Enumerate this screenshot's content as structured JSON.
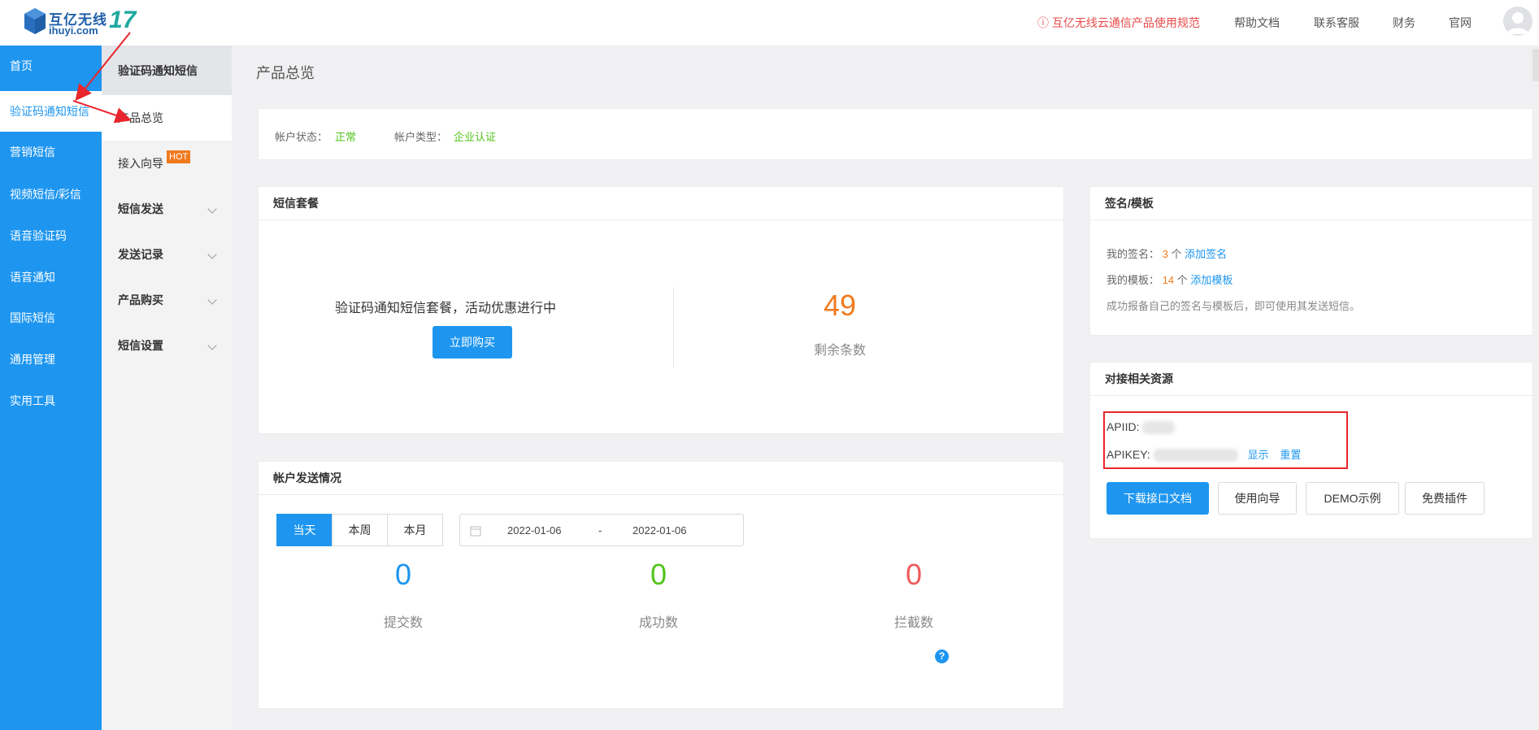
{
  "header": {
    "logo": {
      "brand": "互亿无线",
      "domain": "ihuyi.com",
      "number": "17"
    },
    "notice": "ⓘ 互亿无线云通信产品使用规范",
    "links": [
      "帮助文档",
      "联系客服",
      "财务",
      "官网"
    ]
  },
  "sidebar": {
    "items": [
      {
        "label": "首页"
      },
      {
        "label": "验证码通知短信"
      },
      {
        "label": "营销短信"
      },
      {
        "label": "视频短信/彩信"
      },
      {
        "label": "语音验证码"
      },
      {
        "label": "语音通知"
      },
      {
        "label": "国际短信"
      },
      {
        "label": "通用管理"
      },
      {
        "label": "实用工具"
      }
    ]
  },
  "subsidebar": {
    "title": "验证码通知短信",
    "items": [
      {
        "label": "产品总览"
      },
      {
        "label": "接入向导",
        "badge": "HOT"
      },
      {
        "label": "短信发送"
      },
      {
        "label": "发送记录"
      },
      {
        "label": "产品购买"
      },
      {
        "label": "短信设置"
      }
    ]
  },
  "main": {
    "page_title": "产品总览",
    "account": {
      "status_label": "帐户状态：",
      "status_value": "正常",
      "type_label": "帐户类型：",
      "type_value": "企业认证"
    },
    "package": {
      "title": "短信套餐",
      "promo": "验证码通知短信套餐，活动优惠进行中",
      "buy_button": "立即购买",
      "remaining_value": "49",
      "remaining_label": "剩余条数"
    },
    "sending": {
      "title": "帐户发送情况",
      "tabs": [
        "当天",
        "本周",
        "本月"
      ],
      "date_start": "2022-01-06",
      "date_sep": "-",
      "date_end": "2022-01-06",
      "stats": [
        {
          "value": "0",
          "label": "提交数",
          "color": "#1e96f0"
        },
        {
          "value": "0",
          "label": "成功数",
          "color": "#52c41a"
        },
        {
          "value": "0",
          "label": "拦截数",
          "color": "#f05b5b"
        }
      ],
      "help_icon": "?"
    },
    "signature": {
      "title": "签名/模板",
      "sig_label": "我的签名：",
      "sig_count": "3",
      "sig_unit": "个",
      "sig_add": "添加签名",
      "tpl_label": "我的模板：",
      "tpl_count": "14",
      "tpl_unit": "个",
      "tpl_add": "添加模板",
      "note": "成功报备自己的签名与模板后，即可使用其发送短信。"
    },
    "resources": {
      "title": "对接相关资源",
      "apiid_label": "APIID:",
      "apikey_label": "APIKEY:",
      "show_link": "显示",
      "reset_link": "重置",
      "buttons": [
        "下载接口文档",
        "使用向导",
        "DEMO示例",
        "免费插件"
      ]
    }
  }
}
